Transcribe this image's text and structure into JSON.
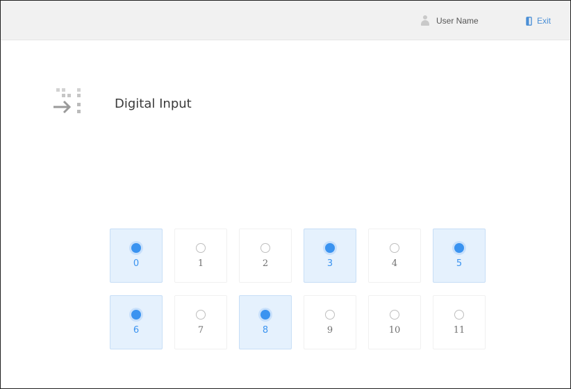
{
  "header": {
    "user_name": "User Name",
    "exit_label": "Exit",
    "user_icon": "user-icon",
    "exit_icon": "exit-door-icon"
  },
  "page": {
    "title": "Digital Input",
    "title_icon": "digital-input-icon"
  },
  "inputs": [
    {
      "label": "0",
      "active": true
    },
    {
      "label": "1",
      "active": false
    },
    {
      "label": "2",
      "active": false
    },
    {
      "label": "3",
      "active": true
    },
    {
      "label": "4",
      "active": false
    },
    {
      "label": "5",
      "active": true
    },
    {
      "label": "6",
      "active": true
    },
    {
      "label": "7",
      "active": false
    },
    {
      "label": "8",
      "active": true
    },
    {
      "label": "9",
      "active": false
    },
    {
      "label": "10",
      "active": false
    },
    {
      "label": "11",
      "active": false
    }
  ],
  "colors": {
    "accent": "#3a93f0",
    "active_bg": "#e5f1fd",
    "link": "#4a8fd6"
  }
}
